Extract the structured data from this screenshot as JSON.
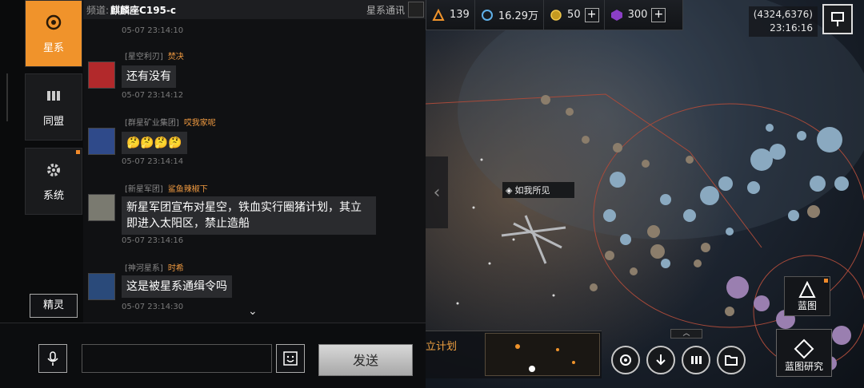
{
  "chat": {
    "channel_key": "频道:",
    "channel_name": "麒麟座C195-c",
    "channel_type": "星系通讯",
    "sidebar": [
      {
        "label": "星系"
      },
      {
        "label": "同盟"
      },
      {
        "label": "系统"
      }
    ],
    "sprite_label": "精灵",
    "top_time": "05-07 23:14:10",
    "messages": [
      {
        "guild": "[星空利刃]",
        "name": "焚决",
        "text": "还有没有",
        "time": "05-07 23:14:12",
        "avatar_color": "#b2292b"
      },
      {
        "guild": "[群星矿业集团]",
        "name": "哎我家呢",
        "text": "🤔🤔🤔🤔",
        "time": "05-07 23:14:14",
        "avatar_color": "#2f4a8a"
      },
      {
        "guild": "[新星军团]",
        "name": "鲨鱼辣椒下",
        "text": "新星军团宣布对星空，铁血实行圈猪计划，其立即进入太阳区，禁止造船",
        "time": "05-07 23:14:16",
        "avatar_color": "#7a7a70"
      },
      {
        "guild": "[神河星系]",
        "name": "时希",
        "text": "这是被星系通缉令吗",
        "time": "05-07 23:14:30",
        "avatar_color": "#2a4a7a"
      }
    ],
    "input": {
      "value": "",
      "send_label": "发送"
    }
  },
  "hud": {
    "fleet_count": "139",
    "credits": "16.29万",
    "gold": "50",
    "premium": "300",
    "coords": "(4324,6376)",
    "clock": "23:16:16",
    "ship_label": "如我所见",
    "blueprint_label": "蓝图",
    "blueprint_research_label": "蓝图研究",
    "plan_label": "立计划"
  },
  "colors": {
    "accent": "#f0932b",
    "name": "#f09a40"
  }
}
